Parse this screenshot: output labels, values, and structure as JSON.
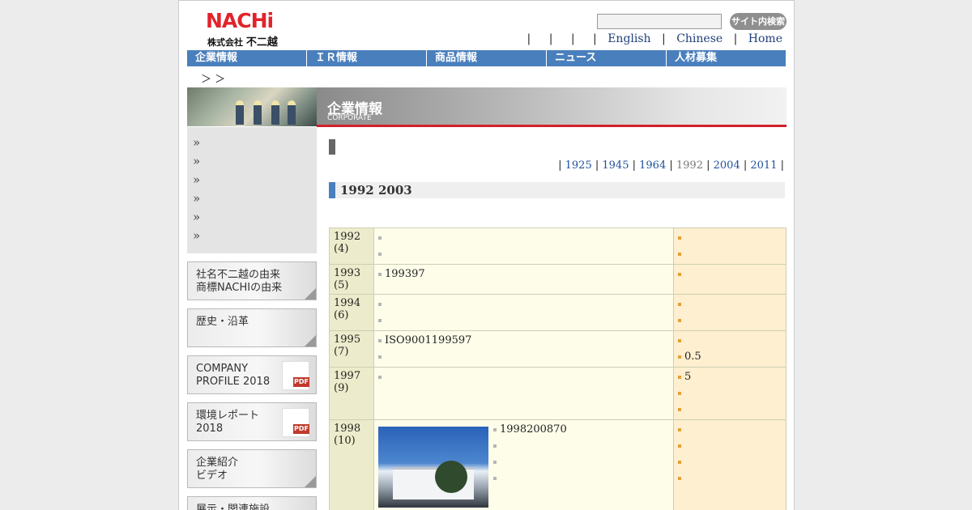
{
  "header": {
    "logo_word": "NACHi",
    "logo_sub_small": "株式会社",
    "logo_sub_big": "不二越",
    "search_button": "サイト内検索",
    "links": [
      "English",
      "Chinese",
      "Home"
    ]
  },
  "nav": [
    "企業情報",
    "ＩＲ情報",
    "商品情報",
    "ニュース",
    "人材募集"
  ],
  "breadcrumb": "＞ ＞",
  "sidebar": {
    "arrow_glyph": "»",
    "arrow_count": 6,
    "banners": [
      {
        "lines": [
          "社名不二越の由来",
          "商標NACHIの由来"
        ],
        "pdf": ""
      },
      {
        "lines": [
          "歴史・沿革"
        ],
        "pdf": ""
      },
      {
        "lines": [
          "COMPANY",
          "PROFILE 2018"
        ],
        "pdf": "PDF"
      },
      {
        "lines": [
          "環境レポート",
          "2018"
        ],
        "pdf": "PDF"
      },
      {
        "lines": [
          "企業紹介",
          "ビデオ"
        ],
        "pdf": ""
      },
      {
        "lines": [
          "展示・関連施設"
        ],
        "pdf": ""
      }
    ]
  },
  "main": {
    "title_jp": "企業情報",
    "title_en": "CORPORATE",
    "years": [
      "1925",
      "1945",
      "1964",
      "1992",
      "2004",
      "2011"
    ],
    "current_year": "1992",
    "section_title": "1992  2003",
    "rows": [
      {
        "year": "1992",
        "age": "(4)",
        "events": [
          "",
          ""
        ],
        "world": [
          "",
          ""
        ]
      },
      {
        "year": "1993",
        "age": "(5)",
        "events": [
          "199397"
        ],
        "world": [
          ""
        ]
      },
      {
        "year": "1994",
        "age": "(6)",
        "events": [
          "",
          ""
        ],
        "world": [
          "",
          ""
        ]
      },
      {
        "year": "1995",
        "age": "(7)",
        "events": [
          "ISO9001199597",
          ""
        ],
        "world": [
          "",
          "0.5"
        ]
      },
      {
        "year": "1997",
        "age": "(9)",
        "events": [
          ""
        ],
        "world": [
          "5",
          "",
          ""
        ]
      },
      {
        "year": "1998",
        "age": "(10)",
        "events": [
          "1998200870",
          "",
          "",
          ""
        ],
        "world": [
          "",
          "",
          "",
          ""
        ]
      }
    ]
  },
  "colors": {
    "brand_red": "#e2232b",
    "nav_blue": "#4a7fbd",
    "accent_red_line": "#d3202b"
  }
}
